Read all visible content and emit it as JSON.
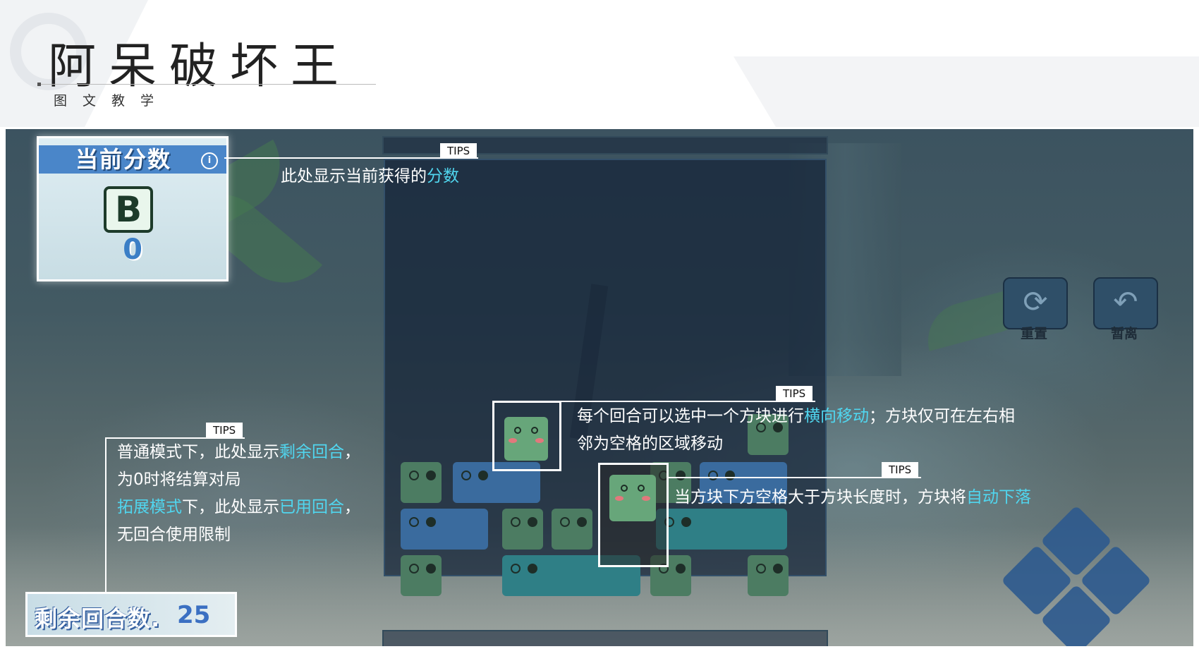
{
  "header": {
    "title": "阿呆破坏王",
    "subtitle": "图文教学"
  },
  "score_panel": {
    "label": "当前分数",
    "info_icon": "i",
    "grade": "B",
    "score": "0"
  },
  "rounds_panel": {
    "label": "剩余回合数.",
    "value": "25"
  },
  "controls": {
    "reset_label": "重置",
    "pause_label": "暂离",
    "reset_icon": "refresh-icon",
    "pause_icon": "back-arrow-icon"
  },
  "tips": {
    "badge": "TIPS",
    "score_tip": {
      "text": "此处显示当前获得的",
      "highlight": "分数"
    },
    "rounds_tip": {
      "line1_a": "普通模式下，此处显示",
      "line1_hl": "剩余回合",
      "line1_b": "，",
      "line2": "为0时将结算对局",
      "line3_hl1": "拓展模式",
      "line3_b": "下，此处显示",
      "line3_hl2": "已用回合",
      "line3_c": "，",
      "line4": "无回合使用限制"
    },
    "move_tip": {
      "line1_a": "每个回合可以选中一个方块进行",
      "line1_hl": "横向移动",
      "line1_b": "；方块仅可在左右相",
      "line2": "邻为空格的区域移动"
    },
    "fall_tip": {
      "text_a": "当方块下方空格大于方块长度时，方块将",
      "text_hl": "自动下落"
    }
  },
  "colors": {
    "highlight": "#50d6ef",
    "tips_bg": "#ffffff"
  }
}
